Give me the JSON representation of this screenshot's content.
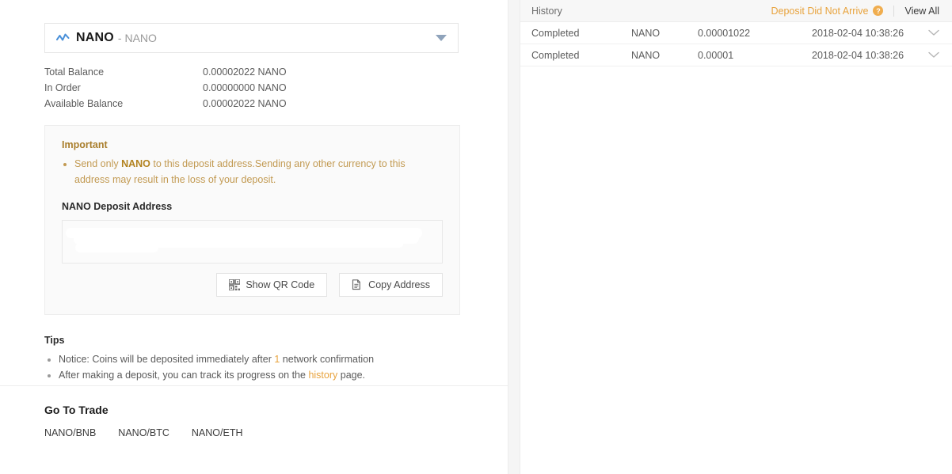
{
  "colors": {
    "accent": "#e8a33d",
    "warning_text": "#c29a52",
    "warning_title": "#a97e2c",
    "coin_icon": "#4a90d9",
    "text": "#5b5b5b"
  },
  "deposit": {
    "selector": {
      "icon": "chart-line-icon",
      "symbol": "NANO",
      "separator": "-",
      "full_name": "NANO",
      "caret": "caret-down-icon"
    },
    "balances": [
      {
        "label": "Total Balance",
        "value": "0.00002022 NANO"
      },
      {
        "label": "In Order",
        "value": "0.00000000 NANO"
      },
      {
        "label": "Available Balance",
        "value": "0.00002022 NANO"
      }
    ],
    "important": {
      "title": "Important",
      "bullet_pre": "Send only ",
      "bullet_bold": "NANO",
      "bullet_post": " to this deposit address.Sending any other currency to this address may result in the loss of your deposit."
    },
    "address_label": "NANO Deposit Address",
    "address_value": "",
    "buttons": {
      "qr_label": "Show QR Code",
      "qr_icon": "qr-code-icon",
      "copy_label": "Copy Address",
      "copy_icon": "copy-document-icon"
    },
    "tips": {
      "title": "Tips",
      "line1_pre": "Notice: Coins will be deposited immediately after ",
      "line1_accent": "1",
      "line1_post": " network confirmation",
      "line2_pre": "After making a deposit, you can track its progress on the ",
      "line2_link": "history",
      "line2_post": " page."
    },
    "trade": {
      "title": "Go To Trade",
      "pairs": [
        "NANO/BNB",
        "NANO/BTC",
        "NANO/ETH"
      ]
    }
  },
  "history": {
    "title": "History",
    "warning_label": "Deposit Did Not Arrive",
    "help_glyph": "?",
    "view_all_label": "View All",
    "rows": [
      {
        "status": "Completed",
        "asset": "NANO",
        "amount": "0.00001022",
        "date": "2018-02-04 10:38:26",
        "expand_icon": "chevron-down-icon"
      },
      {
        "status": "Completed",
        "asset": "NANO",
        "amount": "0.00001",
        "date": "2018-02-04 10:38:26",
        "expand_icon": "chevron-down-icon"
      }
    ]
  }
}
